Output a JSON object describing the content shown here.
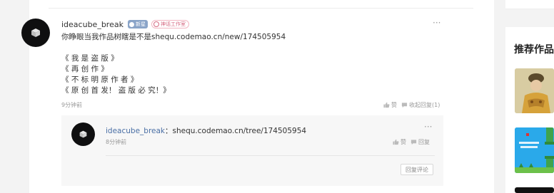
{
  "comment": {
    "username": "ideacube_break",
    "level_badge": "新星",
    "studio_badge": "神话工作室",
    "lines": [
      "你睁眼当我作品树瞎是不是shequ.codemao.cn/new/174505954",
      "",
      "《 我 是 盗 版 》",
      "《 再 创 作 》",
      "《 不 标 明 原 作 者 》",
      "《 原 创 首 发！ 盗 版 必 究！》"
    ],
    "time": "9分钟前",
    "like_label": "赞",
    "collapse_reply_label": "收起回复(1)",
    "more": "···"
  },
  "reply": {
    "username": "ideacube_break",
    "separator": "：",
    "text": "shequ.codemao.cn/tree/174505954",
    "time": "8分钟前",
    "like_label": "赞",
    "reply_label": "回复",
    "reply_comment_button": "回复评论",
    "more": "···"
  },
  "sidebar": {
    "title": "推荐作品"
  },
  "colors": {
    "link": "#4a6fa5",
    "meta": "#999999",
    "studio_badge": "#d56a82",
    "level_badge": "#8aa4c8"
  }
}
